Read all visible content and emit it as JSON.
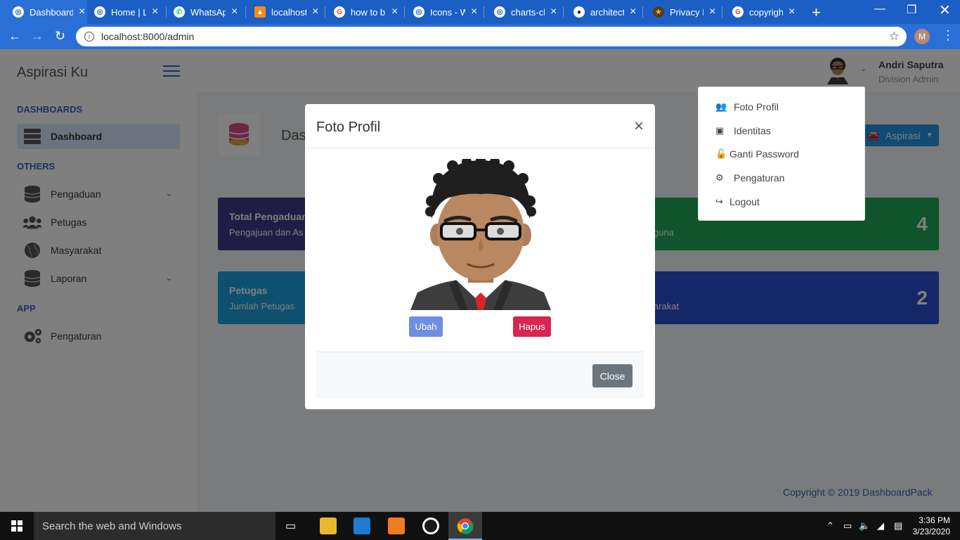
{
  "browser": {
    "tabs": [
      {
        "title": "Dashboard",
        "icon": "chrome-globe-icon"
      },
      {
        "title": "Home | L",
        "icon": "globe-icon"
      },
      {
        "title": "WhatsApp",
        "icon": "whatsapp-icon"
      },
      {
        "title": "localhost",
        "icon": "xampp-icon"
      },
      {
        "title": "how to b",
        "icon": "google-icon"
      },
      {
        "title": "Icons - W",
        "icon": "globe-icon"
      },
      {
        "title": "charts-ch",
        "icon": "globe-icon"
      },
      {
        "title": "architectu",
        "icon": "github-icon"
      },
      {
        "title": "Privacy Po",
        "icon": "star-badge-icon"
      },
      {
        "title": "copyright",
        "icon": "google-icon"
      }
    ],
    "url": "localhost:8000/admin",
    "profile_initial": "M"
  },
  "app": {
    "brand": "Aspirasi Ku",
    "user_name": "Andri Saputra",
    "user_role": "Division Admin",
    "page_title": "Dash",
    "aspirasi_button": "Aspirasi",
    "footer": "Copyright © 2019 DashboardPack"
  },
  "sidebar": {
    "sections": [
      "DASHBOARDS",
      "OTHERS",
      "APP"
    ],
    "items": [
      {
        "label": "Dashboard",
        "icon": "server-icon"
      },
      {
        "label": "Pengaduan",
        "icon": "database-icon"
      },
      {
        "label": "Petugas",
        "icon": "users-icon"
      },
      {
        "label": "Masyarakat",
        "icon": "globe-icon"
      },
      {
        "label": "Laporan",
        "icon": "database-icon"
      },
      {
        "label": "Pengaturan",
        "icon": "gears-icon"
      }
    ]
  },
  "cards": [
    {
      "title": "Total Pengaduan",
      "subtitle": "Pengajuan dan As",
      "value": "",
      "color": "#3f3a8c"
    },
    {
      "title": "",
      "subtitle": "guna",
      "value": "4",
      "color": "#1fa855"
    },
    {
      "title": "Petugas",
      "subtitle": "Jumlah Petugas",
      "value": "",
      "color": "#1aa0de"
    },
    {
      "title": "",
      "subtitle": "arakat",
      "value": "2",
      "color": "#2c4ed0"
    }
  ],
  "dropdown": {
    "items": [
      {
        "label": "Foto Profil",
        "icon": "users-icon"
      },
      {
        "label": "Identitas",
        "icon": "id-card-icon"
      },
      {
        "label": "Ganti Password",
        "icon": "unlock-icon"
      },
      {
        "label": "Pengaturan",
        "icon": "gears-icon"
      },
      {
        "label": "Logout",
        "icon": "sign-out-icon"
      }
    ]
  },
  "modal": {
    "title": "Foto Profil",
    "change_label": "Ubah",
    "delete_label": "Hapus",
    "close_label": "Close",
    "close_symbol": "×"
  },
  "taskbar": {
    "search_placeholder": "Search the web and Windows",
    "time": "3:36 PM",
    "date": "3/23/2020"
  },
  "colors": {
    "accent": "#3a5fc5",
    "chrome_blue": "#1b5ec4",
    "change_btn": "#6d8fe0",
    "delete_btn": "#d92550",
    "close_btn": "#6c757d"
  }
}
